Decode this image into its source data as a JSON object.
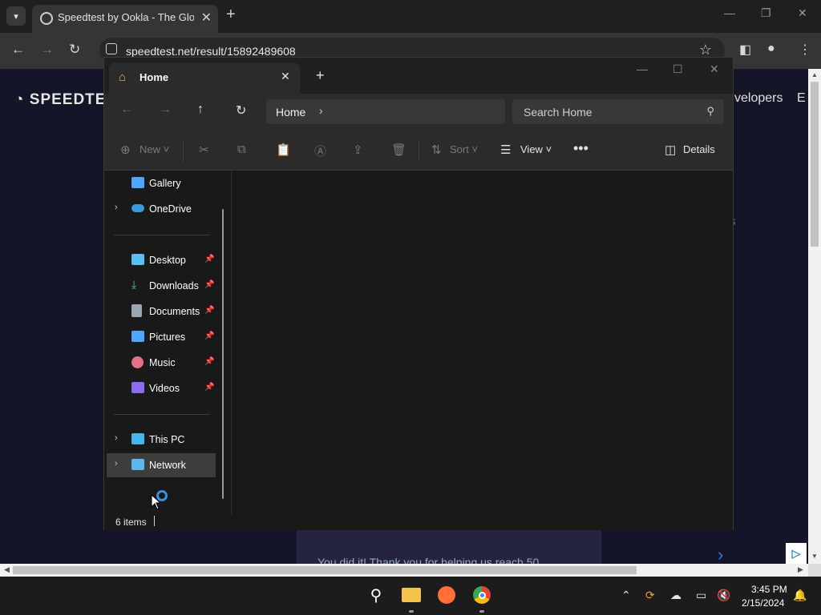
{
  "browser": {
    "tab_title": "Speedtest by Ookla - The Global",
    "url": "speedtest.net/result/15892489608"
  },
  "page": {
    "logo": "SPEEDTE",
    "nav_developers": "velopers",
    "nav_e": "E",
    "edge_s": "s",
    "banner_text": "You did it! Thank you for helping us reach 50",
    "ad_badge": "▷"
  },
  "explorer": {
    "tab_title": "Home",
    "path_label": "Home",
    "search_placeholder": "Search Home",
    "commands": {
      "new": "New",
      "sort": "Sort",
      "view": "View",
      "details": "Details"
    },
    "nav_items": [
      {
        "label": "Gallery",
        "icon": "gallery-icon",
        "color": "#4da6ff"
      },
      {
        "label": "OneDrive",
        "icon": "onedrive-icon",
        "color": "#3a9bdc"
      },
      {
        "label": "Desktop",
        "icon": "desktop-icon",
        "color": "#5bc0eb"
      },
      {
        "label": "Downloads",
        "icon": "downloads-icon",
        "color": "#3ecf8e"
      },
      {
        "label": "Documents",
        "icon": "documents-icon",
        "color": "#9aa6b8"
      },
      {
        "label": "Pictures",
        "icon": "pictures-icon",
        "color": "#4da6ff"
      },
      {
        "label": "Music",
        "icon": "music-icon",
        "color": "#e6708a"
      },
      {
        "label": "Videos",
        "icon": "videos-icon",
        "color": "#8a6cf0"
      },
      {
        "label": "This PC",
        "icon": "this-pc-icon",
        "color": "#45b6e6"
      },
      {
        "label": "Network",
        "icon": "network-icon",
        "color": "#5cb8e6"
      }
    ],
    "status_count": "6 items"
  },
  "taskbar": {
    "time": "3:45 PM",
    "date": "2/15/2024"
  }
}
